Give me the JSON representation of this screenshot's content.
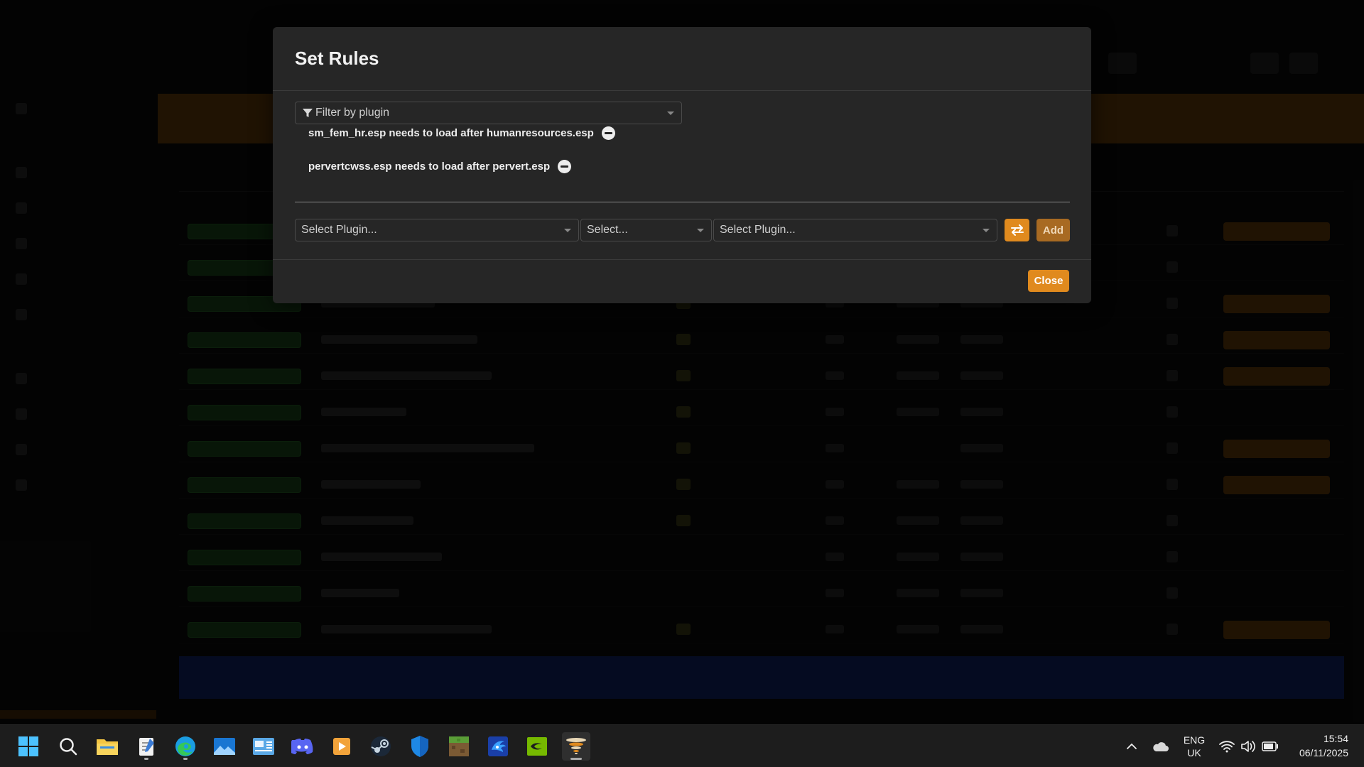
{
  "modal": {
    "title": "Set Rules",
    "filter_placeholder": "Filter by plugin",
    "rules": [
      {
        "text": "sm_fem_hr.esp needs to load after humanresources.esp"
      },
      {
        "text": "pervertcwss.esp needs to load after pervert.esp"
      }
    ],
    "form": {
      "plugin_a_placeholder": "Select Plugin...",
      "relation_placeholder": "Select...",
      "plugin_b_placeholder": "Select Plugin...",
      "add_label": "Add"
    },
    "close_label": "Close"
  },
  "taskbar": {
    "apps": [
      "windows-start",
      "search",
      "file-explorer",
      "notepad",
      "edge",
      "photos",
      "control-panel",
      "discord",
      "media-player",
      "steam",
      "defender",
      "minecraft",
      "sonic",
      "nvidia",
      "vortex"
    ],
    "language": {
      "line1": "ENG",
      "line2": "UK"
    },
    "time": "15:54",
    "date": "06/11/2025"
  },
  "colors": {
    "accent": "#e08a1e",
    "modal_bg": "#262626",
    "taskbar_bg": "#1d1d1d"
  }
}
